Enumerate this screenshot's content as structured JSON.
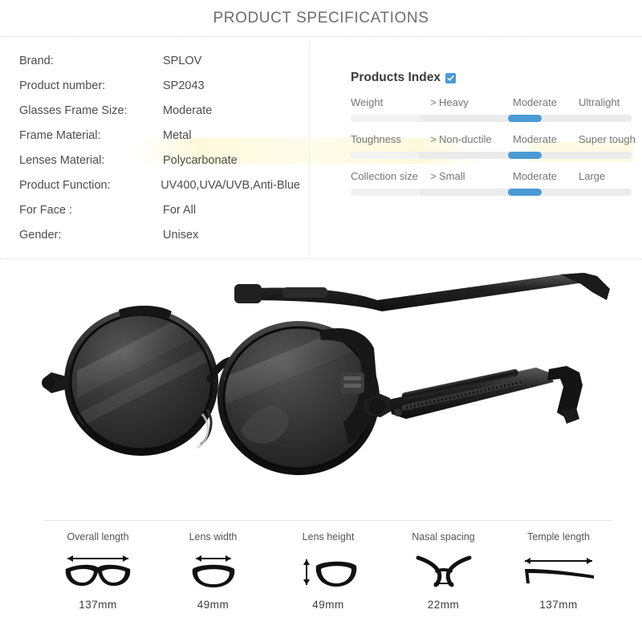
{
  "header": {
    "title": "PRODUCT SPECIFICATIONS"
  },
  "specs": {
    "rows": [
      {
        "label": "Brand:",
        "value": "SPLOV"
      },
      {
        "label": "Product number:",
        "value": "SP2043"
      },
      {
        "label": "Glasses Frame Size:",
        "value": "Moderate"
      },
      {
        "label": "Frame Material:",
        "value": "Metal"
      },
      {
        "label": "Lenses Material:",
        "value": "Polycarbonate"
      },
      {
        "label": "Product Function:",
        "value": "UV400,UVA/UVB,Anti-Blue"
      },
      {
        "label": "For Face :",
        "value": "For All"
      },
      {
        "label": "Gender:",
        "value": "Unisex"
      }
    ]
  },
  "products_index": {
    "title": "Products Index",
    "checkbox_icon": "checkbox-checked-icon",
    "accent_color": "#4a9ad4",
    "track_color": "#ebebeb",
    "rows": [
      {
        "name": "Weight",
        "separator": ">",
        "options": [
          "Heavy",
          "Moderate",
          "Ultralight"
        ],
        "selected": "Moderate",
        "thumb_percent": 62
      },
      {
        "name": "Toughness",
        "separator": ">",
        "options": [
          "Non-ductile",
          "Moderate",
          "Super tough"
        ],
        "selected": "Moderate",
        "thumb_percent": 62
      },
      {
        "name": "Collection size",
        "separator": ">",
        "options": [
          "Small",
          "Moderate",
          "Large"
        ],
        "selected": "Moderate",
        "thumb_percent": 62
      }
    ]
  },
  "product_photo": {
    "alt": "Round black steampunk metal sunglasses with spring temples, three-quarter view"
  },
  "measurements": [
    {
      "label": "Overall length",
      "value": "137mm",
      "icon": "full-frame-width-icon"
    },
    {
      "label": "Lens width",
      "value": "49mm",
      "icon": "lens-width-icon"
    },
    {
      "label": "Lens height",
      "value": "49mm",
      "icon": "lens-height-icon"
    },
    {
      "label": "Nasal spacing",
      "value": "22mm",
      "icon": "bridge-width-icon"
    },
    {
      "label": "Temple length",
      "value": "137mm",
      "icon": "temple-length-icon"
    }
  ]
}
